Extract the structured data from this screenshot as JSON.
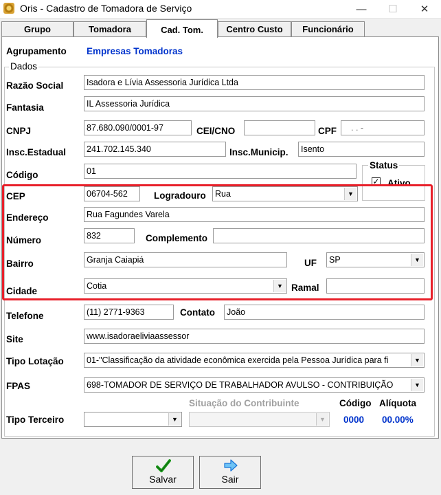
{
  "window": {
    "title": "Oris - Cadastro de Tomadora de Serviço",
    "minimize": "—",
    "maximize": "☐",
    "close": "✕"
  },
  "tabs": [
    "Grupo",
    "Tomadora",
    "Cad. Tom.",
    "Centro Custo",
    "Funcionário"
  ],
  "active_tab": "Cad. Tom.",
  "agrupamento": {
    "label": "Agrupamento",
    "value": "Empresas Tomadoras"
  },
  "dados": {
    "title": "Dados",
    "razao_social": {
      "label": "Razão Social",
      "value": "Isadora e Lívia Assessoria Jurídica Ltda"
    },
    "fantasia": {
      "label": "Fantasia",
      "value": "IL Assessoria Jurídica"
    },
    "cnpj": {
      "label": "CNPJ",
      "value": "87.680.090/0001-97"
    },
    "cei_cno": {
      "label": "CEI/CNO",
      "value": ""
    },
    "cpf": {
      "label": "CPF",
      "value": ".   .   -"
    },
    "insc_estadual": {
      "label": "Insc.Estadual",
      "value": "241.702.145.340"
    },
    "insc_municip": {
      "label": "Insc.Municip.",
      "value": "Isento"
    },
    "codigo": {
      "label": "Código",
      "value": "01"
    },
    "status": {
      "title": "Status",
      "ativo_label": "Ativo",
      "ativo_checked": true,
      "check_mark": "✓"
    },
    "cep": {
      "label": "CEP",
      "value": "06704-562"
    },
    "logradouro": {
      "label": "Logradouro",
      "value": "Rua"
    },
    "endereco": {
      "label": "Endereço",
      "value": "Rua Fagundes Varela"
    },
    "numero": {
      "label": "Número",
      "value": "832"
    },
    "complemento": {
      "label": "Complemento",
      "value": ""
    },
    "bairro": {
      "label": "Bairro",
      "value": "Granja Caiapiá"
    },
    "uf": {
      "label": "UF",
      "value": "SP"
    },
    "cidade": {
      "label": "Cidade",
      "value": "Cotia"
    },
    "ramal": {
      "label": "Ramal",
      "value": ""
    },
    "telefone": {
      "label": "Telefone",
      "value": "(11) 2771-9363"
    },
    "contato": {
      "label": "Contato",
      "value": "João"
    },
    "site": {
      "label": "Site",
      "value": "www.isadoraeliviaassessor"
    },
    "tipo_lotacao": {
      "label": "Tipo Lotação",
      "value": "01-\"Classificação da atividade econômica exercida pela Pessoa Jurídica para fi"
    },
    "fpas": {
      "label": "FPAS",
      "value": "698-TOMADOR DE SERVIÇO DE TRABALHADOR AVULSO - CONTRIBUIÇÃO"
    },
    "tipo_terceiro": {
      "label": "Tipo Terceiro",
      "value": ""
    },
    "situacao_contribuinte": {
      "label": "Situação do Contribuinte",
      "value": ""
    },
    "codigo_terceiro": {
      "label": "Código",
      "value": "0000"
    },
    "aliquota": {
      "label": "Alíquota",
      "value": "00.00%"
    }
  },
  "buttons": {
    "salvar": "Salvar",
    "sair": "Sair"
  },
  "colors": {
    "link_blue": "#0033cc",
    "highlight_red": "#e8202a",
    "check_green": "#1a9a1a",
    "arrow_blue": "#1874d6"
  }
}
